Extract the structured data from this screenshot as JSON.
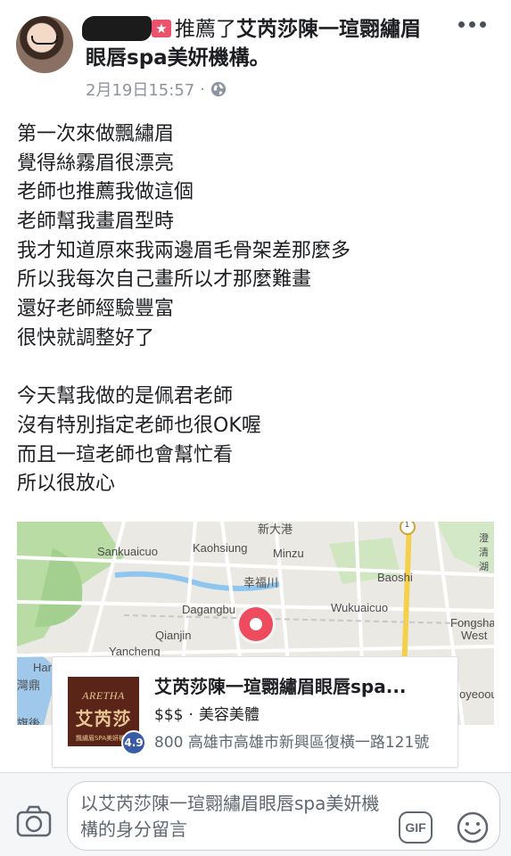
{
  "post": {
    "author_badge": "★",
    "action": "推薦了",
    "page_name_line1": "艾芮莎陳一瑄翾繡眉",
    "page_name_line2": "眼唇spa美妍機構。",
    "timestamp": "2月19日15:57",
    "separator": "·",
    "body_lines": [
      "第一次來做飄繡眉",
      "覺得絲霧眉很漂亮",
      "老師也推薦我做這個",
      "老師幫我畫眉型時",
      "我才知道原來我兩邊眉毛骨架差那麼多",
      "所以我每次自己畫所以才那麼難畫",
      "還好老師經驗豐富",
      "很快就調整好了",
      "",
      "今天幫我做的是佩君老師",
      "沒有特別指定老師也很OK喔",
      "而且一瑄老師也會幫忙看",
      "所以很放心"
    ]
  },
  "map": {
    "labels": [
      "新大港",
      "Sankuaicuo",
      "Kaohsiung",
      "Minzu",
      "Baoshi",
      "幸福川",
      "Dagangbu",
      "Wukuaicuo",
      "Fongshan",
      "West",
      "Qianjin",
      "Yancheng",
      "Ham",
      "灣鼎",
      "旗後",
      "oyeoou",
      "1",
      "澄清湖"
    ]
  },
  "place": {
    "name": "艾芮莎陳一瑄翾繡眉眼唇spa...",
    "price": "$$$",
    "meta_separator": "·",
    "category": "美容美體",
    "address": "800 高雄市高雄市新興區復橫一路121號",
    "rating": "4.9",
    "logo_brand": "ARETHA",
    "logo_cn": "艾芮莎",
    "logo_sub": "飄繡眉SPA美妍機構"
  },
  "comment": {
    "placeholder": "以艾芮莎陳一瑄翾繡眉眼唇spa美妍機構的身分留言",
    "gif_label": "GIF"
  },
  "colors": {
    "accent_pin": "#ef4b5e",
    "rating_badge": "#3a5ca6",
    "logo_bg": "#5a2418"
  },
  "icons": [
    "more-icon",
    "globe-icon",
    "map-pin-icon",
    "camera-icon",
    "gif-icon",
    "emoji-icon"
  ]
}
